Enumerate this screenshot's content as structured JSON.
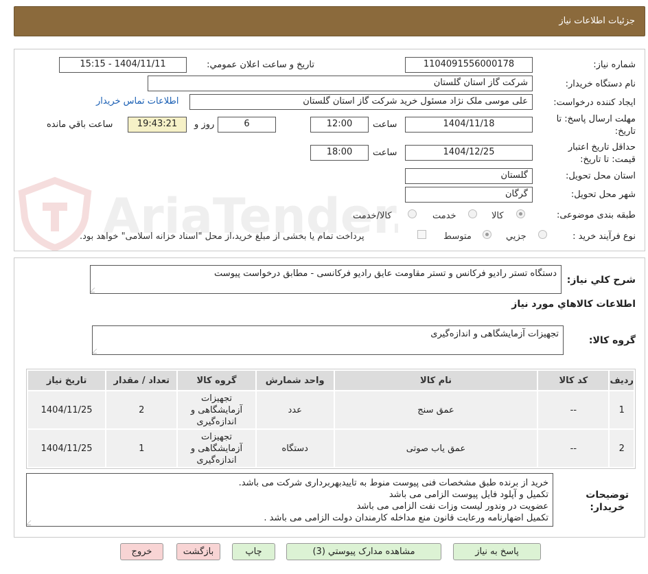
{
  "header": {
    "title": "جزئیات اطلاعات نیاز"
  },
  "watermark": {
    "text": "AriaTender.neT"
  },
  "form": {
    "need_number_label": "شماره نیاز:",
    "need_number": "1104091556000178",
    "announce_label": "تاریخ و ساعت اعلان عمومي:",
    "announce_value": "1404/11/11 - 15:15",
    "buyer_org_label": "نام دستگاه خریدار:",
    "buyer_org": "شرکت گاز استان گلستان",
    "creator_label": "ایجاد کننده درخواست:",
    "creator": "علی موسی ملک نژاد مسئول خرید شرکت گاز استان گلستان",
    "contact_link": "اطلاعات تماس خریدار",
    "deadline_label": "مهلت ارسال پاسخ: تا تاریخ:",
    "deadline_date": "1404/11/18",
    "time_label": "ساعت",
    "deadline_time": "12:00",
    "days_value": "6",
    "days_label": "روز و",
    "remaining_time": "19:43:21",
    "remaining_label": "ساعت باقي مانده",
    "validity_label": "حداقل تاریخ اعتبار قیمت: تا تاریخ:",
    "validity_date": "1404/12/25",
    "validity_time": "18:00",
    "province_label": "استان محل تحویل:",
    "province": "گلستان",
    "city_label": "شهر محل تحویل:",
    "city": "گرگان",
    "category_label": "طبقه بندی موضوعی:",
    "category_options": [
      "کالا",
      "خدمت",
      "کالا/خدمت"
    ],
    "process_label": "نوع فرآیند خرید :",
    "process_options": [
      "جزیي",
      "متوسط"
    ],
    "payment_note": "پرداخت تمام یا بخشی از مبلغ خرید،از محل \"اسناد خزانه اسلامی\" خواهد بود."
  },
  "description": {
    "label": "شرح كلي نياز:",
    "text": "دستگاه تستر رادیو فرکانس  و  تستر  مقاومت عایق رادیو  فرکانسی  -  مطابق درخواست پیوست"
  },
  "goods": {
    "section_title": "اطلاعات كالاهاي مورد نياز",
    "group_label": "گروه کالا:",
    "group_value": "تجهیزات آزمایشگاهی و اندازه‌گیری",
    "columns": [
      "ردیف",
      "کد کالا",
      "نام کالا",
      "واحد شمارش",
      "گروه کالا",
      "تعداد / مقدار",
      "تاریخ نیاز"
    ],
    "rows": [
      {
        "index": "1",
        "code": "--",
        "name": "عمق سنج",
        "unit": "عدد",
        "group_l1": "تجهیزات",
        "group_l2": "آزمایشگاهی و",
        "group_l3": "اندازه‌گیری",
        "qty": "2",
        "date": "1404/11/25"
      },
      {
        "index": "2",
        "code": "--",
        "name": "عمق یاب صوتی",
        "unit": "دستگاه",
        "group_l1": "تجهیزات",
        "group_l2": "آزمایشگاهی و",
        "group_l3": "اندازه‌گیری",
        "qty": "1",
        "date": "1404/11/25"
      }
    ]
  },
  "notes": {
    "label_l1": "توضیحات",
    "label_l2": "خریدار:",
    "lines": [
      "خرید از برنده طبق مشخصات فنی پیوست منوط به تاییدبهربرداری شرکت می باشد.",
      "تکمیل و آپلود فایل پیوست الزامی می باشد",
      "عضویت در وندور لیست وزات نفت  الزامی می باشد",
      "تکمیل اضهارنامه ورعایت قانون منع مداخله کارمندان دولت الزامی می باشد ."
    ]
  },
  "buttons": {
    "reply": "پاسخ به نیاز",
    "view_docs": "مشاهده مدارک پیوستي (3)",
    "print": "چاپ",
    "back": "بازگشت",
    "exit": "خروج"
  },
  "colors": {
    "header_bg": "#8b6a3c",
    "link": "#1a5fb4",
    "green_btn": "#dcf2d4",
    "pink_btn": "#f8d4d4"
  }
}
